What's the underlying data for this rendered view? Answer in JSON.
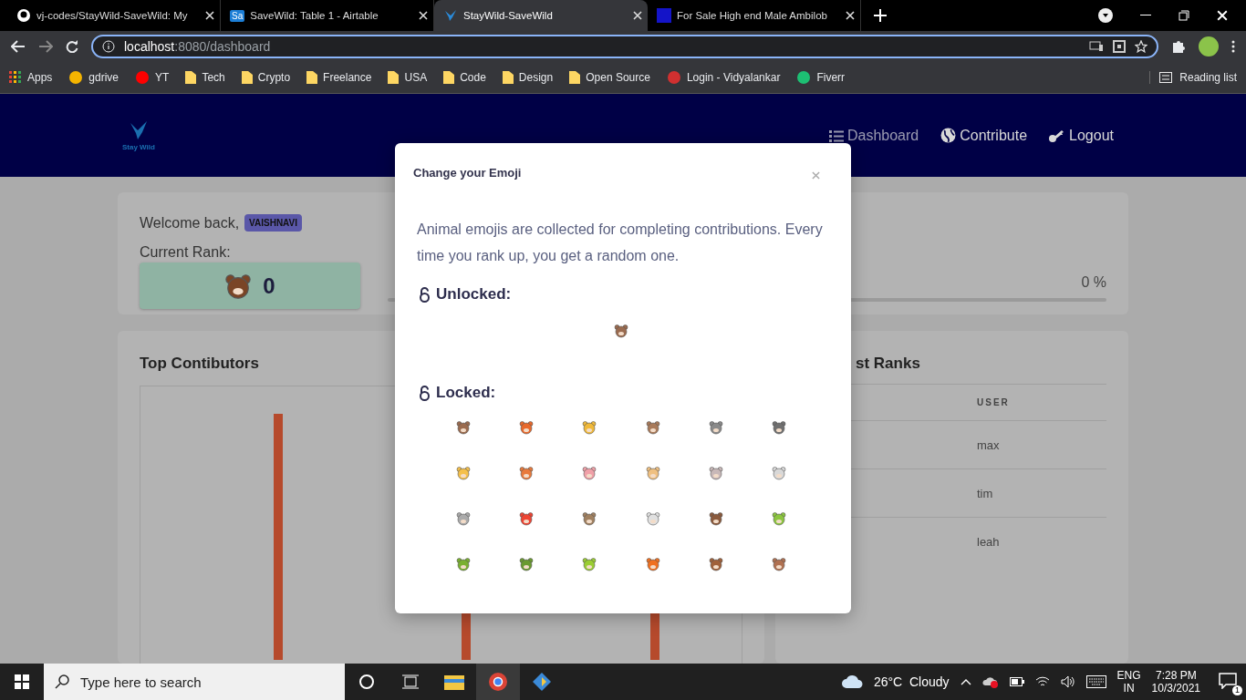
{
  "browser": {
    "tabs": [
      {
        "title": "vj-codes/StayWild-SaveWild: My",
        "selected": false
      },
      {
        "title": "SaveWild: Table 1 - Airtable",
        "badge": "Sa",
        "selected": false
      },
      {
        "title": "StayWild-SaveWild",
        "selected": true
      },
      {
        "title": "For Sale High end Male Ambilob",
        "selected": false
      }
    ],
    "address": {
      "host": "localhost",
      "path": ":8080/dashboard"
    },
    "bookmarks": [
      {
        "label": "Apps",
        "kind": "apps"
      },
      {
        "label": "gdrive",
        "kind": "site",
        "color": "#f4b400"
      },
      {
        "label": "YT",
        "kind": "site",
        "color": "#ff0000"
      },
      {
        "label": "Tech",
        "kind": "folder"
      },
      {
        "label": "Crypto",
        "kind": "folder"
      },
      {
        "label": "Freelance",
        "kind": "folder"
      },
      {
        "label": "USA",
        "kind": "folder"
      },
      {
        "label": "Code",
        "kind": "folder"
      },
      {
        "label": "Design",
        "kind": "folder"
      },
      {
        "label": "Open Source",
        "kind": "folder"
      },
      {
        "label": "Login - Vidyalankar",
        "kind": "site",
        "color": "#d03030"
      },
      {
        "label": "Fiverr",
        "kind": "site",
        "color": "#1dbf73"
      }
    ],
    "reading_list": "Reading list"
  },
  "navbar": {
    "logo": "Stay Wild",
    "links": [
      {
        "label": "Dashboard",
        "selected": true
      },
      {
        "label": "Contribute",
        "selected": false
      },
      {
        "label": "Logout",
        "selected": false
      }
    ]
  },
  "welcome": {
    "text": "Welcome back,",
    "user": "VAISHNAVI",
    "rank_label": "Current Rank:",
    "rank_emoji": {
      "color": "#7a4526"
    },
    "rank": "0",
    "progress": "0 %",
    "level": 0
  },
  "contributors": {
    "title": "Top Contibutors"
  },
  "ranks": {
    "title": "st Ranks",
    "column": "USER",
    "rows": [
      "max",
      "tim",
      "leah"
    ]
  },
  "modal": {
    "title": "Change your Emoji",
    "text": "Animal emojis are collected for completing contributions. Every time you rank up, you get a random one.",
    "unlocked_label": "Unlocked:",
    "unlocked": [
      {
        "color": "#9a6b4f"
      }
    ],
    "locked_label": "Locked:",
    "locked": [
      {
        "color": "#9a6b4f"
      },
      {
        "color": "#e8692c"
      },
      {
        "color": "#f0b93a"
      },
      {
        "color": "#a87a5a"
      },
      {
        "color": "#8a8a8a"
      },
      {
        "color": "#707070"
      },
      {
        "color": "#f5c04a"
      },
      {
        "color": "#e87a3c"
      },
      {
        "color": "#f0a0a8"
      },
      {
        "color": "#f0c080"
      },
      {
        "color": "#c8b8b8"
      },
      {
        "color": "#d8d8d8"
      },
      {
        "color": "#aaaaaa"
      },
      {
        "color": "#ee4433"
      },
      {
        "color": "#a08060"
      },
      {
        "color": "#e0e0e0"
      },
      {
        "color": "#8b5a3c"
      },
      {
        "color": "#8cc63f"
      },
      {
        "color": "#7ab030"
      },
      {
        "color": "#6a9a30"
      },
      {
        "color": "#9acd32"
      },
      {
        "color": "#f07020"
      },
      {
        "color": "#a0603a"
      },
      {
        "color": "#b07050"
      }
    ]
  },
  "taskbar": {
    "search": "Type here to search",
    "weather": "26°C  Cloudy",
    "lang": "ENG",
    "region": "IN",
    "time": "7:28 PM",
    "date": "10/3/2021",
    "notifications": "1"
  }
}
